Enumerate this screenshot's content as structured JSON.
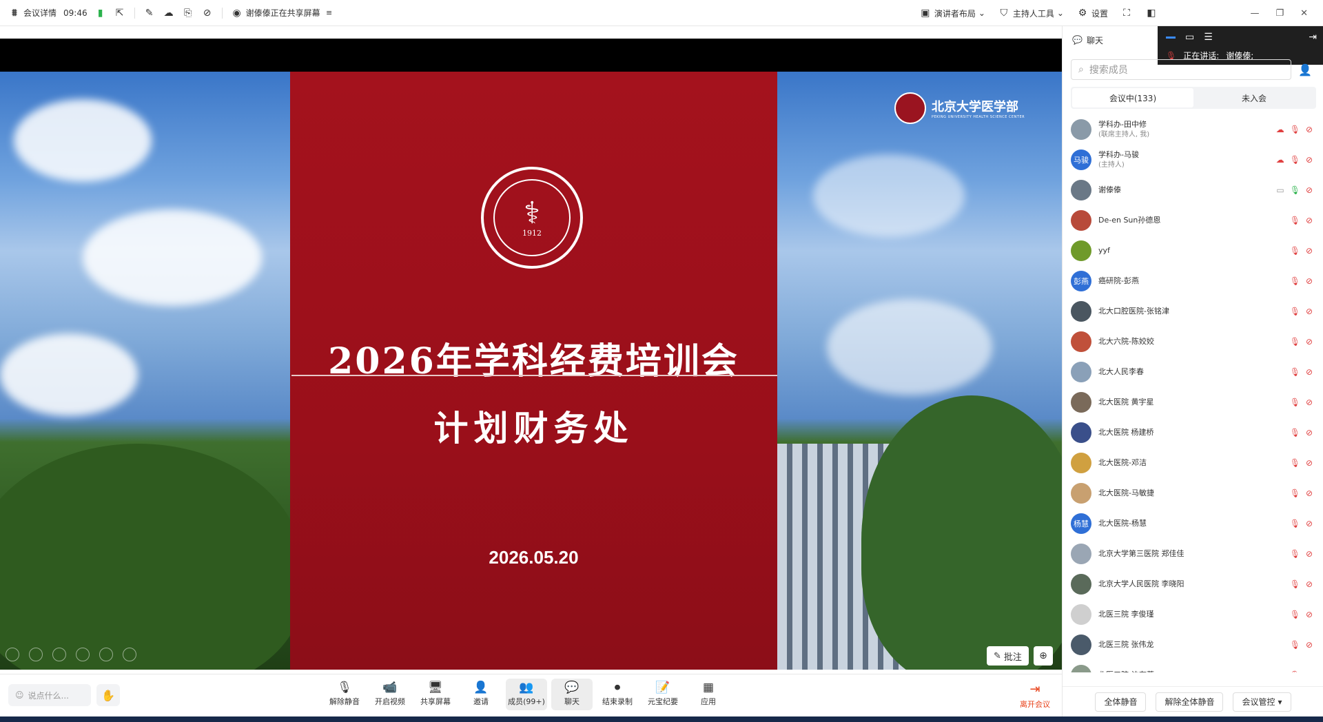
{
  "topbar": {
    "meeting_info": "会议详情",
    "time": "09:46",
    "share_status": "谢傣傣正在共享屏幕",
    "layout": "演讲者布局",
    "host_tools": "主持人工具",
    "settings": "设置"
  },
  "slide": {
    "title": "2026年学科经费培训会",
    "subtitle": "计划财务处",
    "date": "2026.05.20",
    "seal_year": "1912",
    "corner_logo_cn": "北京大学医学部",
    "corner_logo_en": "PEKING UNIVERSITY HEALTH SCIENCE CENTER",
    "annotate_label": "批注"
  },
  "speaker": {
    "label": "正在讲话:",
    "name": "谢傣傣;"
  },
  "panel": {
    "chat_label": "聊天",
    "search_placeholder": "搜索成员",
    "tab_in_meeting": "会议中(133)",
    "tab_not_joined": "未入会",
    "participants": [
      {
        "name": "学科办-田中修",
        "role": "(联席主持人, 我)",
        "avatar": "",
        "avatar_color": "#8a9aa8"
      },
      {
        "name": "学科办-马骏",
        "role": "(主持人)",
        "avatar": "马骏",
        "avatar_color": "#2f6fd6"
      },
      {
        "name": "谢傣傣",
        "role": "",
        "avatar": "",
        "avatar_color": "#6a7886"
      },
      {
        "name": "De-en Sun孙德恩",
        "role": "",
        "avatar": "",
        "avatar_color": "#b84a3a"
      },
      {
        "name": "yyf",
        "role": "",
        "avatar": "",
        "avatar_color": "#6f9a2a"
      },
      {
        "name": "癌研院-彭燕",
        "role": "",
        "avatar": "彭燕",
        "avatar_color": "#2f6fd6"
      },
      {
        "name": "北大口腔医院-张铭津",
        "role": "",
        "avatar": "",
        "avatar_color": "#4a5660"
      },
      {
        "name": "北大六院-陈姣姣",
        "role": "",
        "avatar": "",
        "avatar_color": "#c0503a"
      },
      {
        "name": "北大人民李春",
        "role": "",
        "avatar": "",
        "avatar_color": "#8aa0b8"
      },
      {
        "name": "北大医院 黄宇星",
        "role": "",
        "avatar": "",
        "avatar_color": "#7a6a5a"
      },
      {
        "name": "北大医院 杨建桥",
        "role": "",
        "avatar": "",
        "avatar_color": "#3a4f8a"
      },
      {
        "name": "北大医院-邓洁",
        "role": "",
        "avatar": "",
        "avatar_color": "#d0a040"
      },
      {
        "name": "北大医院-马敏捷",
        "role": "",
        "avatar": "",
        "avatar_color": "#c8a070"
      },
      {
        "name": "北大医院-杨慧",
        "role": "",
        "avatar": "杨慧",
        "avatar_color": "#2f6fd6"
      },
      {
        "name": "北京大学第三医院 郑佳佳",
        "role": "",
        "avatar": "",
        "avatar_color": "#9aa6b4"
      },
      {
        "name": "北京大学人民医院 李晓阳",
        "role": "",
        "avatar": "",
        "avatar_color": "#5a6a5a"
      },
      {
        "name": "北医三院 李俊瑾",
        "role": "",
        "avatar": "",
        "avatar_color": "#cfcfcf"
      },
      {
        "name": "北医三院 张伟龙",
        "role": "",
        "avatar": "",
        "avatar_color": "#4a5a6a"
      },
      {
        "name": "北医三院-边有蓉",
        "role": "",
        "avatar": "",
        "avatar_color": "#8a9a8a"
      }
    ],
    "mute_all": "全体静音",
    "unmute_all": "解除全体静音",
    "meeting_control": "会议管控"
  },
  "bottombar": {
    "say_placeholder": "说点什么...",
    "tools": [
      {
        "label": "解除静音",
        "icon": "mic-off-icon",
        "glyph": "🎙"
      },
      {
        "label": "开启视频",
        "icon": "video-off-icon",
        "glyph": "📹"
      },
      {
        "label": "共享屏幕",
        "icon": "share-screen-icon",
        "glyph": "🖥"
      },
      {
        "label": "邀请",
        "icon": "invite-icon",
        "glyph": "👤"
      },
      {
        "label": "成员(99+)",
        "icon": "members-icon",
        "glyph": "👥"
      },
      {
        "label": "聊天",
        "icon": "chat-icon",
        "glyph": "💬"
      },
      {
        "label": "结束录制",
        "icon": "record-icon",
        "glyph": "⏺"
      },
      {
        "label": "元宝纪要",
        "icon": "notes-icon",
        "glyph": "📝"
      },
      {
        "label": "应用",
        "icon": "apps-icon",
        "glyph": "▦"
      }
    ],
    "leave_label": "离开会议"
  },
  "colors": {
    "slide_red": "#9a0f1a",
    "leave_red": "#e8421a",
    "accent_blue": "#2f6fd6",
    "mic_off_red": "#e04040",
    "mic_on_green": "#2bb24c"
  }
}
